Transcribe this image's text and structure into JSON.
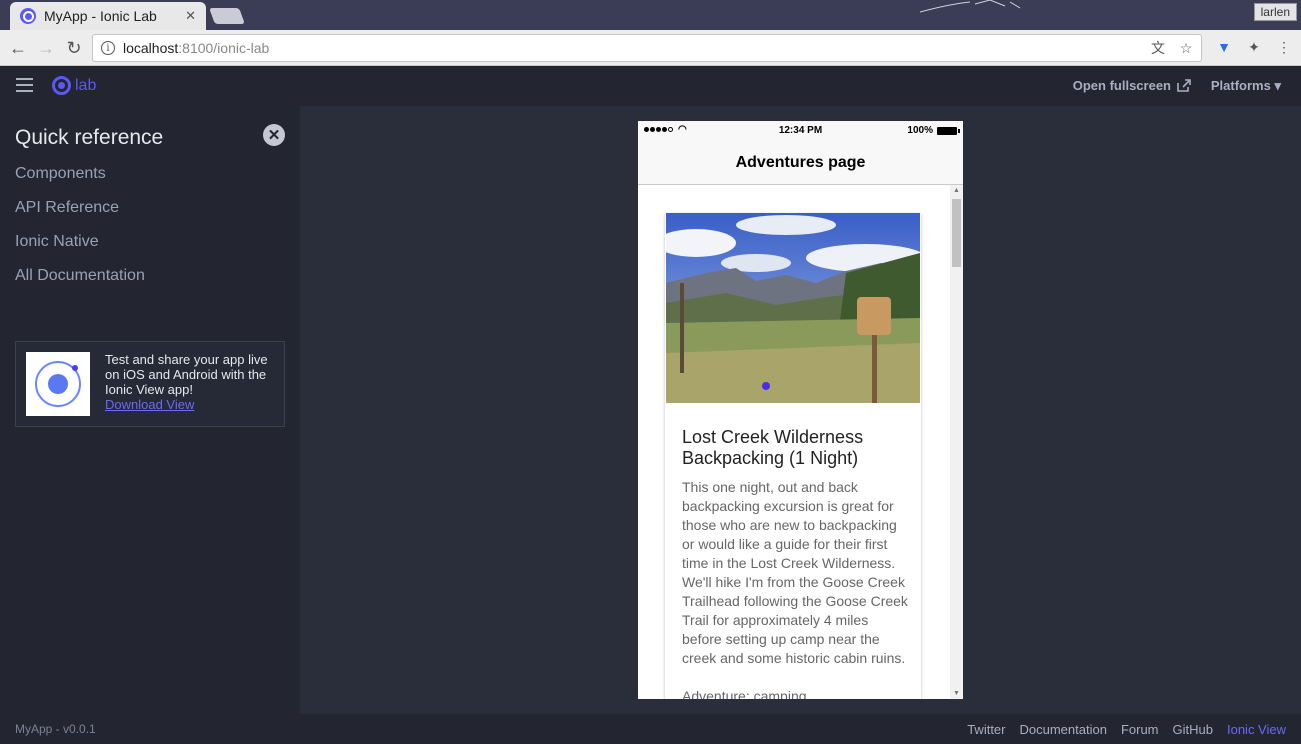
{
  "browser": {
    "tab_title": "MyApp - Ionic Lab",
    "tab_close": "✕",
    "url_host": "localhost",
    "url_path": ":8100/ionic-lab",
    "user": "larlen"
  },
  "lab_header": {
    "logo_text": "lab",
    "open_fullscreen": "Open fullscreen",
    "platforms": "Platforms"
  },
  "sidebar": {
    "title": "Quick reference",
    "close_icon": "✕",
    "links": [
      "Components",
      "API Reference",
      "Ionic Native",
      "All Documentation"
    ],
    "promo_text": "Test and share your app live on iOS and Android with the Ionic View app!",
    "promo_link": "Download View"
  },
  "device": {
    "status_time": "12:34 PM",
    "status_battery": "100%",
    "nav_title": "Adventures page",
    "card": {
      "title": "Lost Creek Wilderness Backpacking (1 Night)",
      "description": "This one night, out and back backpacking excursion is great for those who are new to backpacking or would like a guide for their first time in the Lost Creek Wilderness. We'll hike I'm from the Goose Creek Trailhead following the Goose Creek Trail for approximately 4 miles before setting up camp near the creek and some historic cabin ruins.",
      "type": "Adventure: camping"
    }
  },
  "footer": {
    "version": "MyApp - v0.0.1",
    "links": [
      "Twitter",
      "Documentation",
      "Forum",
      "GitHub",
      "Ionic View"
    ]
  },
  "colors": {
    "accent": "#5b58f5",
    "dark_bg": "#232530",
    "main_bg": "#2a2e3a"
  }
}
